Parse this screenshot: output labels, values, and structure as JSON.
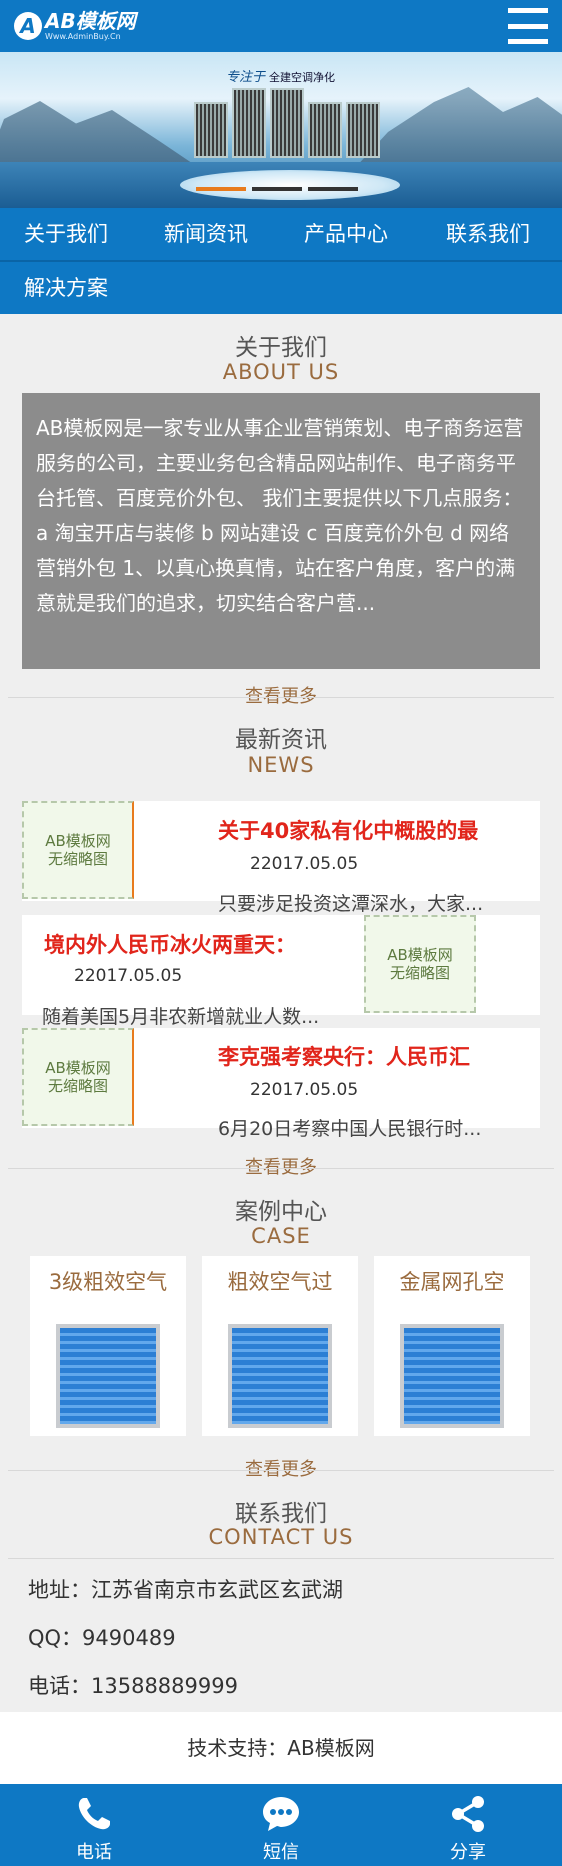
{
  "header": {
    "logo_letter": "A",
    "logo_name": "AB模板网",
    "logo_url": "Www.AdminBuy.Cn",
    "menu_icon": "hamburger-menu-icon"
  },
  "banner": {
    "tagline_script": "专注于",
    "tagline": "全建空调净化"
  },
  "nav": {
    "items": [
      "关于我们",
      "新闻资讯",
      "产品中心",
      "联系我们",
      "解决方案"
    ]
  },
  "about": {
    "title": "关于我们",
    "subtitle": "ABOUT US",
    "text": "AB模板网是一家专业从事企业营销策划、电子商务运营服务的公司，主要业务包含精品网站制作、电子商务平台托管、百度竞价外包、 我们主要提供以下几点服务： a 淘宝开店与装修 b 网站建设 c 百度竞价外包 d 网络营销外包 1、以真心换真情，站在客户角度，客户的满意就是我们的追求，切实结合客户营...",
    "more": "查看更多"
  },
  "news": {
    "title": "最新资讯",
    "subtitle": "NEWS",
    "thumb_line1": "AB模板网",
    "thumb_line2": "无缩略图",
    "items": [
      {
        "title": "关于40家私有化中概股的最",
        "date": "22017.05.05",
        "desc": "只要涉足投资这潭深水，大家..."
      },
      {
        "title": "境内外人民币冰火两重天：",
        "date": "22017.05.05",
        "desc": "随着美国5月非农新增就业人数..."
      },
      {
        "title": "李克强考察央行：人民币汇",
        "date": "22017.05.05",
        "desc": "6月20日考察中国人民银行时..."
      }
    ],
    "more": "查看更多"
  },
  "cases": {
    "title": "案例中心",
    "subtitle": "CASE",
    "items": [
      {
        "name": "3级粗效空气"
      },
      {
        "name": "粗效空气过"
      },
      {
        "name": "金属网孔空"
      }
    ],
    "more": "查看更多"
  },
  "contact": {
    "title": "联系我们",
    "subtitle": "CONTACT US",
    "address": "地址：江苏省南京市玄武区玄武湖",
    "qq": "QQ：9490489",
    "phone": "电话：13588889999"
  },
  "support": "技术支持：AB模板网",
  "footer": {
    "items": [
      {
        "label": "电话",
        "icon": "phone-icon"
      },
      {
        "label": "短信",
        "icon": "sms-icon"
      },
      {
        "label": "分享",
        "icon": "share-icon"
      }
    ]
  },
  "colors": {
    "primary_blue": "#0e78c4",
    "accent_brown": "#9a6b3e",
    "news_red": "#e1251b"
  }
}
